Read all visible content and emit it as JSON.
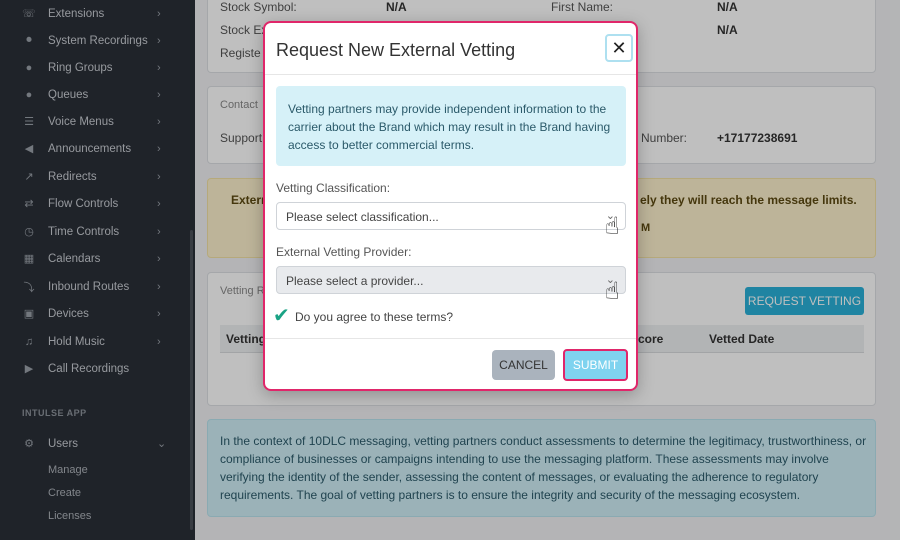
{
  "sidebar": {
    "items": [
      {
        "label": "Extensions",
        "icon": "phone-icon"
      },
      {
        "label": "System Recordings",
        "icon": "microphone-icon"
      },
      {
        "label": "Ring Groups",
        "icon": "group-icon"
      },
      {
        "label": "Queues",
        "icon": "users-icon"
      },
      {
        "label": "Voice Menus",
        "icon": "list-icon"
      },
      {
        "label": "Announcements",
        "icon": "megaphone-icon"
      },
      {
        "label": "Redirects",
        "icon": "redirect-icon"
      },
      {
        "label": "Flow Controls",
        "icon": "flow-icon"
      },
      {
        "label": "Time Controls",
        "icon": "clock-icon"
      },
      {
        "label": "Calendars",
        "icon": "calendar-icon"
      },
      {
        "label": "Inbound Routes",
        "icon": "route-icon"
      },
      {
        "label": "Devices",
        "icon": "device-icon"
      },
      {
        "label": "Hold Music",
        "icon": "music-icon"
      },
      {
        "label": "Call Recordings",
        "icon": "recording-icon"
      }
    ],
    "section": "INTULSE APP",
    "users": {
      "label": "Users",
      "icon": "users-gear-icon"
    },
    "sub_items": [
      "Manage",
      "Create",
      "Licenses"
    ]
  },
  "background": {
    "stock_symbol_label": "Stock Symbol:",
    "stock_symbol_value": "N/A",
    "stock_ex_label": "Stock Ex",
    "register_label": "Registe",
    "first_name_label": "First Name:",
    "first_name_value": "N/A",
    "second_value": "N/A",
    "contact_label": "Contact",
    "support_label": "Support",
    "number_label": "Number:",
    "number_value": "+17177238691",
    "warning_left": "Extern",
    "warning_right": "ely they will reach the message limits.",
    "warning_small": "M",
    "vetting_label": "Vetting R",
    "request_vetting": "REQUEST VETTING",
    "table_col_vetting": "Vetting",
    "table_col_score": "core",
    "table_col_date": "Vetted Date",
    "info_paragraph": "In the context of 10DLC messaging, vetting partners conduct assessments to determine the legitimacy, trustworthiness, or compliance of businesses or campaigns intending to use the messaging platform. These assessments may involve verifying the identity of the sender, assessing the content of messages, or evaluating the adherence to regulatory requirements. The goal of vetting partners is to ensure the integrity and security of the messaging ecosystem."
  },
  "modal": {
    "title": "Request New External Vetting",
    "info": "Vetting partners may provide independent information to the carrier about the Brand which may result in the Brand having access to better commercial terms.",
    "classification_label": "Vetting Classification:",
    "classification_placeholder": "Please select classification...",
    "provider_label": "External Vetting Provider:",
    "provider_placeholder": "Please select a provider...",
    "terms": "Do you agree to these terms?",
    "cancel": "CANCEL",
    "submit": "SUBMIT"
  },
  "colors": {
    "accent": "#e0266a",
    "info_bg": "#d6f1f8",
    "submit_bg": "#7fd3ef",
    "sidebar_bg": "#2a2f37"
  }
}
